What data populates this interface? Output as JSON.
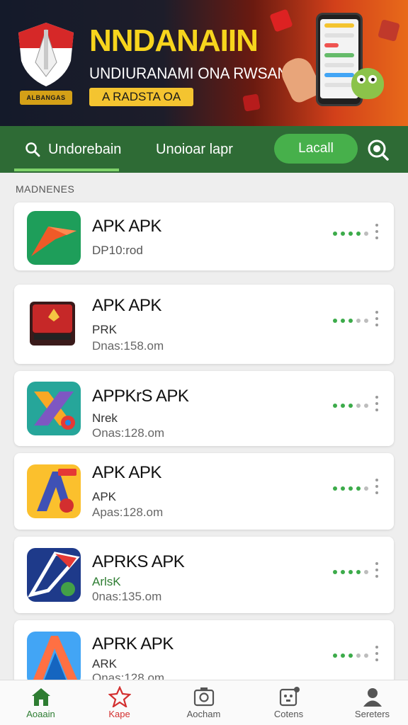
{
  "banner": {
    "title": "NNDANAIIN",
    "subtitle": "UNDIURANAMI ONA RWSAN",
    "cta": "A RADSTA OA",
    "badge": "ALBANGAS"
  },
  "tabs": {
    "search_label": "Undorebain",
    "second_label": "Unoioar lapr",
    "pill_label": "Lacall"
  },
  "section": {
    "label": "MADNENES"
  },
  "apps": [
    {
      "name": "APK APK",
      "line1": "DP10:rod",
      "line2": "",
      "icon": "arrow-app-icon",
      "dots": [
        1,
        1,
        1,
        1,
        0
      ]
    },
    {
      "name": "APK APK",
      "line1": "PRK",
      "line2": "Dnas:158.om",
      "icon": "red-cube-app-icon",
      "dots": [
        1,
        1,
        1,
        0,
        0
      ]
    },
    {
      "name": "APPKrS APK",
      "line1": "Nrek",
      "line2": "Onas:128.om",
      "icon": "x-cross-app-icon",
      "dots": [
        1,
        1,
        1,
        0,
        0
      ]
    },
    {
      "name": "APK APK",
      "line1": "APK",
      "line2": "Apas:128.om",
      "icon": "letter-a-app-icon",
      "dots": [
        1,
        1,
        1,
        1,
        0
      ]
    },
    {
      "name": "APRKS APK",
      "line1": "ArlsK",
      "line2": "0nas:135.om",
      "icon": "blue-arrow-app-icon",
      "dots": [
        1,
        1,
        1,
        1,
        0
      ]
    },
    {
      "name": "APRK APK",
      "line1": "ARK",
      "line2": "Onas:128.om",
      "icon": "orange-a-app-icon",
      "dots": [
        1,
        1,
        1,
        0,
        0
      ]
    }
  ],
  "bottom_nav": [
    {
      "label": "Aoaain",
      "icon": "home-icon",
      "color": "#2e7d32"
    },
    {
      "label": "Kape",
      "icon": "star-icon",
      "color": "#d32f2f"
    },
    {
      "label": "Aocham",
      "icon": "camera-icon",
      "color": "#555555"
    },
    {
      "label": "Cotens",
      "icon": "contacts-icon",
      "color": "#555555"
    },
    {
      "label": "Sereters",
      "icon": "user-icon",
      "color": "#555555"
    }
  ],
  "colors": {
    "primary_green": "#2e6b35",
    "accent_green": "#47b04b",
    "banner_yellow": "#f7d51d"
  }
}
